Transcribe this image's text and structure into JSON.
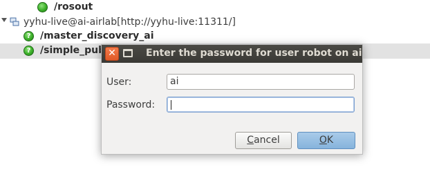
{
  "tree": {
    "rosout": {
      "label": "/rosout",
      "icon": "green-status-icon"
    },
    "host": {
      "label": "yyhu-live@ai-airlab[http://yyhu-live:11311/]",
      "icon": "host-icon"
    },
    "master_discovery": {
      "label": "/master_discovery_ai",
      "icon": "warning-status-icon"
    },
    "simple_pub": {
      "label": "/simple_pub",
      "icon": "warning-status-icon"
    }
  },
  "dialog": {
    "title": "Enter the password for user robot on ai-airlab",
    "user_label": "User:",
    "user_value": "ai",
    "password_label": "Password:",
    "password_value": "",
    "cancel_label_mnemonic": "C",
    "cancel_label_rest": "ancel",
    "ok_label_mnemonic": "O",
    "ok_label_rest": "K"
  },
  "colors": {
    "titlebar": "#3c3b37",
    "close_button": "#e05a28",
    "ok_button": "#86b3dc",
    "selection_row": "#e2e2e2",
    "status_green": "#3cb029"
  }
}
